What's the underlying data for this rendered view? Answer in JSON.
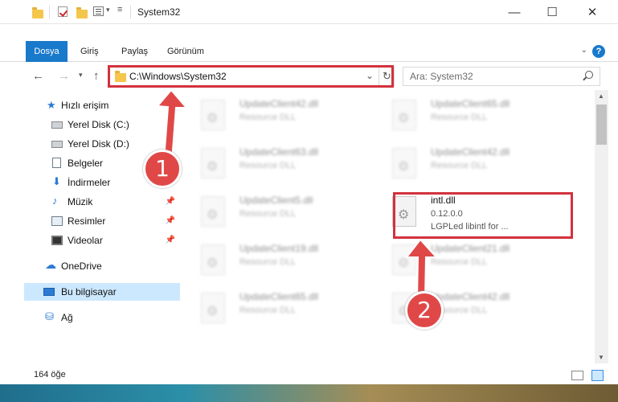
{
  "window": {
    "title": "System32",
    "minimize_label": "—",
    "maximize_label": "☐",
    "close_label": "✕"
  },
  "ribbon": {
    "tabs": [
      "Dosya",
      "Giriş",
      "Paylaş",
      "Görünüm"
    ],
    "help_label": "?"
  },
  "address": {
    "path": "C:\\Windows\\System32",
    "search_placeholder": "Ara: System32"
  },
  "nav": {
    "quick_access": "Hızlı erişim",
    "items": [
      {
        "label": "Yerel Disk (C:)",
        "icon": "drive-icon",
        "pinned": true
      },
      {
        "label": "Yerel Disk (D:)",
        "icon": "drive-icon",
        "pinned": true
      },
      {
        "label": "Belgeler",
        "icon": "documents-icon",
        "pinned": true
      },
      {
        "label": "İndirmeler",
        "icon": "downloads-icon",
        "pinned": true
      },
      {
        "label": "Müzik",
        "icon": "music-icon",
        "pinned": true
      },
      {
        "label": "Resimler",
        "icon": "pictures-icon",
        "pinned": true
      },
      {
        "label": "Videolar",
        "icon": "videos-icon",
        "pinned": true
      }
    ],
    "onedrive": "OneDrive",
    "this_pc": "Bu bilgisayar",
    "network": "Ağ"
  },
  "files": [
    {
      "name": "UpdateClient42.dll",
      "sub": "Resource DLL"
    },
    {
      "name": "UpdateClient65.dll",
      "sub": "Resource DLL"
    },
    {
      "name": "UpdateClient63.dll",
      "sub": "Resource DLL"
    },
    {
      "name": "UpdateClient42.dll",
      "sub": "Resource DLL"
    },
    {
      "name": "UpdateClient5.dll",
      "sub": "Resource DLL"
    },
    {
      "name": "UpdateClient19.dll",
      "sub": "Resource DLL"
    },
    {
      "name": "UpdateClient21.dll",
      "sub": "Resource DLL"
    },
    {
      "name": "UpdateClient65.dll",
      "sub": "Resource DLL"
    },
    {
      "name": "UpdateClient42.dll",
      "sub": "Resource DLL"
    }
  ],
  "highlighted_file": {
    "name": "intl.dll",
    "version": "0.12.0.0",
    "description": "LGPLed libintl for ..."
  },
  "status": {
    "count": "164 öğe"
  },
  "callouts": {
    "step1": "1",
    "step2": "2"
  },
  "colors": {
    "accent": "#1979ca",
    "highlight": "#d2323d",
    "selection": "#cce8ff"
  }
}
